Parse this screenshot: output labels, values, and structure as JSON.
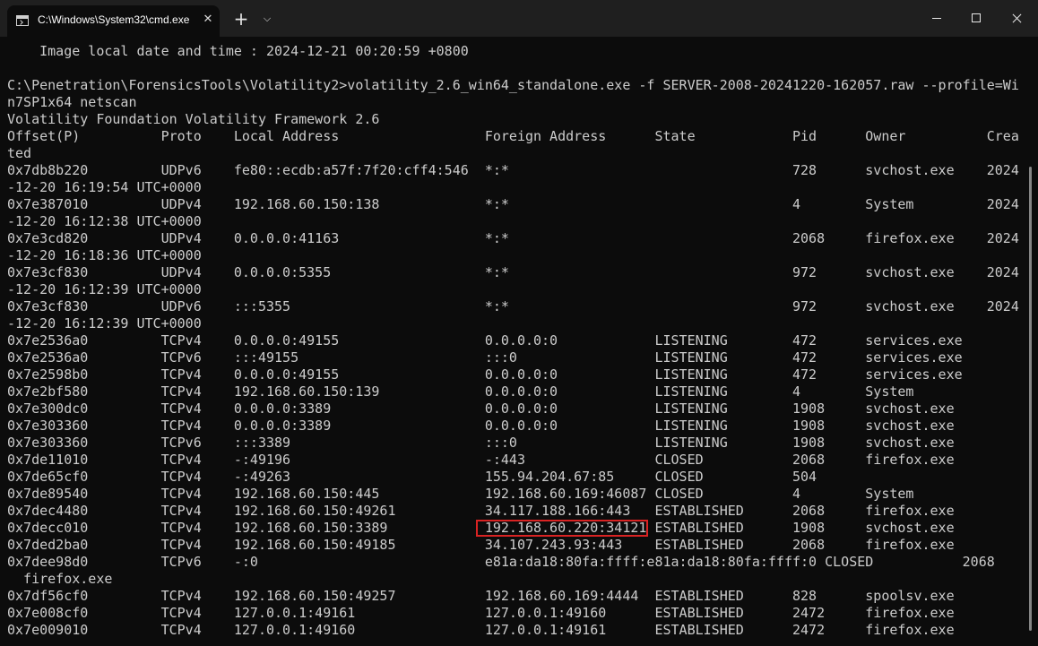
{
  "window": {
    "tab_title": "C:\\Windows\\System32\\cmd.exe",
    "tab_close_icon": "✕",
    "new_tab_icon": "+",
    "dropdown_icon": "⌵"
  },
  "colors": {
    "background": "#0c0c0c",
    "titlebar": "#1f1f1f",
    "text": "#cccccc",
    "highlight_border": "#d92323"
  },
  "console": {
    "lines": [
      "    Image local date and time : 2024-12-21 00:20:59 +0800",
      "",
      "C:\\Penetration\\ForensicsTools\\Volatility2>volatility_2.6_win64_standalone.exe -f SERVER-2008-20241220-162057.raw --profile=Wi",
      "n7SP1x64 netscan",
      "Volatility Foundation Volatility Framework 2.6",
      "Offset(P)          Proto    Local Address                  Foreign Address      State            Pid      Owner          Crea",
      "ted",
      "0x7db8b220         UDPv6    fe80::ecdb:a57f:7f20:cff4:546  *:*                                   728      svchost.exe    2024",
      "-12-20 16:19:54 UTC+0000",
      "0x7e387010         UDPv4    192.168.60.150:138             *:*                                   4        System         2024",
      "-12-20 16:12:38 UTC+0000",
      "0x7e3cd820         UDPv4    0.0.0.0:41163                  *:*                                   2068     firefox.exe    2024",
      "-12-20 16:18:36 UTC+0000",
      "0x7e3cf830         UDPv4    0.0.0.0:5355                   *:*                                   972      svchost.exe    2024",
      "-12-20 16:12:39 UTC+0000",
      "0x7e3cf830         UDPv6    :::5355                        *:*                                   972      svchost.exe    2024",
      "-12-20 16:12:39 UTC+0000",
      "0x7e2536a0         TCPv4    0.0.0.0:49155                  0.0.0.0:0            LISTENING        472      services.exe",
      "0x7e2536a0         TCPv6    :::49155                       :::0                 LISTENING        472      services.exe",
      "0x7e2598b0         TCPv4    0.0.0.0:49155                  0.0.0.0:0            LISTENING        472      services.exe",
      "0x7e2bf580         TCPv4    192.168.60.150:139             0.0.0.0:0            LISTENING        4        System",
      "0x7e300dc0         TCPv4    0.0.0.0:3389                   0.0.0.0:0            LISTENING        1908     svchost.exe",
      "0x7e303360         TCPv4    0.0.0.0:3389                   0.0.0.0:0            LISTENING        1908     svchost.exe",
      "0x7e303360         TCPv6    :::3389                        :::0                 LISTENING        1908     svchost.exe",
      "0x7de11010         TCPv4    -:49196                        -:443                CLOSED           2068     firefox.exe",
      "0x7de65cf0         TCPv4    -:49263                        155.94.204.67:85     CLOSED           504",
      "0x7de89540         TCPv4    192.168.60.150:445             192.168.60.169:46087 CLOSED           4        System",
      "0x7dec4480         TCPv4    192.168.60.150:49261           34.117.188.166:443   ESTABLISHED      2068     firefox.exe",
      "0x7decc010         TCPv4    192.168.60.150:3389            192.168.60.220:34121 ESTABLISHED      1908     svchost.exe",
      "0x7ded2ba0         TCPv4    192.168.60.150:49185           34.107.243.93:443    ESTABLISHED      2068     firefox.exe",
      "0x7dee98d0         TCPv6    -:0                            e81a:da18:80fa:ffff:e81a:da18:80fa:ffff:0 CLOSED           2068",
      "  firefox.exe",
      "0x7df56cf0         TCPv4    192.168.60.150:49257           192.168.60.169:4444  ESTABLISHED      828      spoolsv.exe",
      "0x7e008cf0         TCPv4    127.0.0.1:49161                127.0.0.1:49160      ESTABLISHED      2472     firefox.exe",
      "0x7e009010         TCPv4    127.0.0.1:49160                127.0.0.1:49161      ESTABLISHED      2472     firefox.exe"
    ]
  }
}
